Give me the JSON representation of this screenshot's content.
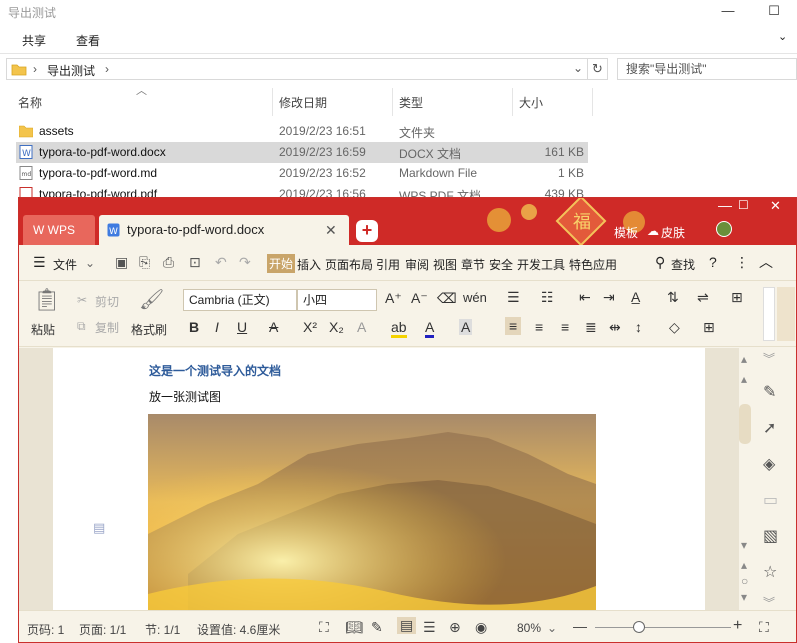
{
  "explorer": {
    "title": "导出测试",
    "ribbon": {
      "share": "共享",
      "view": "查看"
    },
    "address": {
      "crumb": "导出测试"
    },
    "search_placeholder": "搜索\"导出测试\"",
    "columns": {
      "name": "名称",
      "date": "修改日期",
      "type": "类型",
      "size": "大小"
    },
    "files": [
      {
        "name": "assets",
        "date": "2019/2/23 16:51",
        "type": "文件夹",
        "size": ""
      },
      {
        "name": "typora-to-pdf-word.docx",
        "date": "2019/2/23 16:59",
        "type": "DOCX 文档",
        "size": "161 KB"
      },
      {
        "name": "typora-to-pdf-word.md",
        "date": "2019/2/23 16:52",
        "type": "Markdown File",
        "size": "1 KB"
      },
      {
        "name": "typora-to-pdf-word.pdf",
        "date": "2019/2/23 16:56",
        "type": "WPS PDF 文档",
        "size": "439 KB"
      }
    ]
  },
  "wps": {
    "app_tab": "WPS",
    "doc_tab": "typora-to-pdf-word.docx",
    "header_right": {
      "skin": "皮肤",
      "mode": "模板"
    },
    "menu": {
      "file": "文件",
      "items": [
        "开始",
        "插入",
        "页面布局",
        "引用",
        "审阅",
        "视图",
        "章节",
        "安全",
        "开发工具",
        "特色应用"
      ],
      "search": "查找"
    },
    "toolbar": {
      "paste": "粘贴",
      "cut": "剪切",
      "copy": "复制",
      "format_painter": "格式刷",
      "font_name": "Cambria (正文)",
      "font_size": "小四"
    },
    "document": {
      "heading": "这是一个测试导入的文档",
      "line1": "放一张测试图"
    },
    "status": {
      "page_num": "页码: 1",
      "pages": "页面: 1/1",
      "section": "节: 1/1",
      "setting": "设置值: 4.6厘米",
      "zoom": "80%"
    }
  }
}
